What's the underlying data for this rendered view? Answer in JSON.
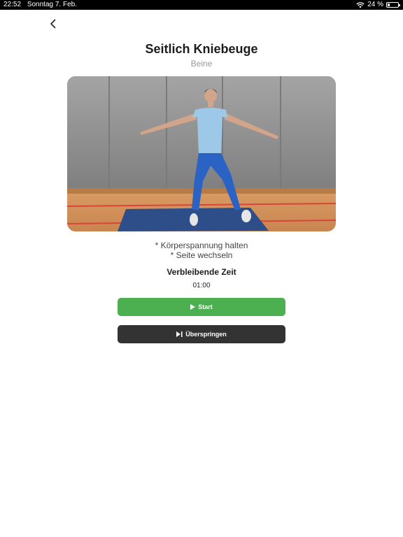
{
  "status_bar": {
    "time": "22:52",
    "date": "Sonntag 7. Feb.",
    "battery_percent_label": "24 %",
    "battery_level": 0.24
  },
  "header": {
    "title": "Seitlich Kniebeuge",
    "category": "Beine"
  },
  "hints": [
    "* Körperspannung halten",
    "* Seite wechseln"
  ],
  "timer": {
    "label": "Verbleibende Zeit",
    "value": "01:00"
  },
  "buttons": {
    "start_label": "Start",
    "skip_label": "Überspringen"
  },
  "colors": {
    "start": "#4caf50",
    "skip": "#333333",
    "title": "#1c1c1c",
    "subtitle": "#9a9a9a"
  }
}
